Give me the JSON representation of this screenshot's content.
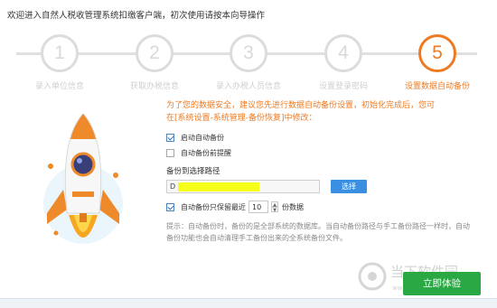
{
  "header": {
    "title": "欢迎进入自然人税收管理系统扣缴客户端，初次使用请按本向导操作"
  },
  "steps": [
    {
      "num": "1",
      "label": "录入单位信息",
      "active": false
    },
    {
      "num": "2",
      "label": "获取办税信息",
      "active": false
    },
    {
      "num": "3",
      "label": "录入办税人员信息",
      "active": false
    },
    {
      "num": "4",
      "label": "设置登录密码",
      "active": false
    },
    {
      "num": "5",
      "label": "设置数据自动备份",
      "active": true
    }
  ],
  "content": {
    "intro": "为了您的数据安全，建议您先进行数据自动备份设置，初始化完成后，您可在[系统设置-系统管理-备份恢复]中修改：",
    "auto_backup_label": "启动自动备份",
    "auto_backup_checked": true,
    "backup_reminder_label": "自动备份前提醒",
    "backup_reminder_checked": false,
    "path_label": "备份到选择路径",
    "path_value": "D",
    "browse_label": "选择",
    "keep_prefix": "自动备份只保留最近",
    "keep_checked": true,
    "keep_value": "10",
    "keep_suffix": "份数据",
    "hint": "提示：自动备份时，备份的是全部系统的数据库。当自动备份路径与手工备份路径一样时，自动备份功能也会自动清理手工备份出来的全系统备份文件。"
  },
  "watermark": {
    "text": "当下软件园",
    "url": "www.downxia.com"
  },
  "start_button": {
    "label": "立即体验"
  },
  "colors": {
    "accent": "#ee7b23",
    "inactive": "#dcdcdc",
    "browse": "#3a8fe0",
    "start": "#2aa844"
  }
}
